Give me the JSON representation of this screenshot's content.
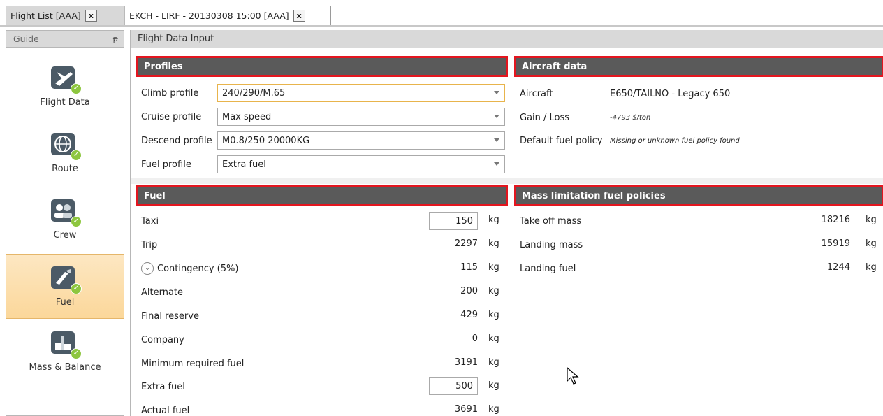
{
  "tabs": [
    {
      "label": "Flight List [AAA]",
      "close": "x"
    },
    {
      "label": "EKCH - LIRF - 20130308 15:00 [AAA]",
      "close": "x"
    }
  ],
  "guide": {
    "title": "Guide",
    "pin": "ᵽ",
    "items": [
      {
        "label": "Flight Data",
        "icon": "plane-icon"
      },
      {
        "label": "Route",
        "icon": "globe-icon"
      },
      {
        "label": "Crew",
        "icon": "crew-icon"
      },
      {
        "label": "Fuel",
        "icon": "fuel-icon"
      },
      {
        "label": "Mass & Balance",
        "icon": "scale-icon"
      }
    ],
    "check": "✓"
  },
  "main": {
    "title": "Flight Data Input",
    "profiles": {
      "title": "Profiles",
      "rows": [
        {
          "label": "Climb profile",
          "value": "240/290/M.65"
        },
        {
          "label": "Cruise profile",
          "value": "Max speed"
        },
        {
          "label": "Descend profile",
          "value": "M0.8/250 20000KG"
        },
        {
          "label": "Fuel profile",
          "value": "Extra fuel"
        }
      ]
    },
    "aircraft": {
      "title": "Aircraft data",
      "aircraft_label": "Aircraft",
      "aircraft_value": "E650/TAILNO - Legacy 650",
      "gain_label": "Gain / Loss",
      "gain_value": "-4793 $/ton",
      "policy_label": "Default fuel policy",
      "policy_value": "Missing or unknown fuel policy found"
    },
    "fuel": {
      "title": "Fuel",
      "unit": "kg",
      "rows": [
        {
          "label": "Taxi",
          "value": "150",
          "editable": true
        },
        {
          "label": "Trip",
          "value": "2297"
        },
        {
          "label": "Contingency (5%)",
          "value": "115",
          "expand": "⌄"
        },
        {
          "label": "Alternate",
          "value": "200"
        },
        {
          "label": "Final reserve",
          "value": "429"
        },
        {
          "label": "Company",
          "value": "0"
        },
        {
          "label": "Minimum required fuel",
          "value": "3191"
        },
        {
          "label": "Extra fuel",
          "value": "500",
          "editable": true
        },
        {
          "label": "Actual fuel",
          "value": "3691"
        }
      ]
    },
    "mass": {
      "title": "Mass limitation fuel policies",
      "unit": "kg",
      "rows": [
        {
          "label": "Take off mass",
          "value": "18216"
        },
        {
          "label": "Landing mass",
          "value": "15919"
        },
        {
          "label": "Landing fuel",
          "value": "1244"
        }
      ]
    }
  }
}
